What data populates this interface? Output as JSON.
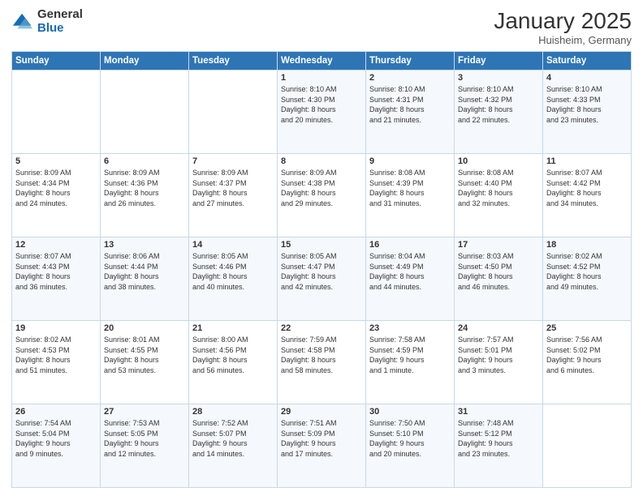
{
  "header": {
    "logo_general": "General",
    "logo_blue": "Blue",
    "month_title": "January 2025",
    "location": "Huisheim, Germany"
  },
  "days_of_week": [
    "Sunday",
    "Monday",
    "Tuesday",
    "Wednesday",
    "Thursday",
    "Friday",
    "Saturday"
  ],
  "weeks": [
    [
      {
        "day": "",
        "info": ""
      },
      {
        "day": "",
        "info": ""
      },
      {
        "day": "",
        "info": ""
      },
      {
        "day": "1",
        "info": "Sunrise: 8:10 AM\nSunset: 4:30 PM\nDaylight: 8 hours\nand 20 minutes."
      },
      {
        "day": "2",
        "info": "Sunrise: 8:10 AM\nSunset: 4:31 PM\nDaylight: 8 hours\nand 21 minutes."
      },
      {
        "day": "3",
        "info": "Sunrise: 8:10 AM\nSunset: 4:32 PM\nDaylight: 8 hours\nand 22 minutes."
      },
      {
        "day": "4",
        "info": "Sunrise: 8:10 AM\nSunset: 4:33 PM\nDaylight: 8 hours\nand 23 minutes."
      }
    ],
    [
      {
        "day": "5",
        "info": "Sunrise: 8:09 AM\nSunset: 4:34 PM\nDaylight: 8 hours\nand 24 minutes."
      },
      {
        "day": "6",
        "info": "Sunrise: 8:09 AM\nSunset: 4:36 PM\nDaylight: 8 hours\nand 26 minutes."
      },
      {
        "day": "7",
        "info": "Sunrise: 8:09 AM\nSunset: 4:37 PM\nDaylight: 8 hours\nand 27 minutes."
      },
      {
        "day": "8",
        "info": "Sunrise: 8:09 AM\nSunset: 4:38 PM\nDaylight: 8 hours\nand 29 minutes."
      },
      {
        "day": "9",
        "info": "Sunrise: 8:08 AM\nSunset: 4:39 PM\nDaylight: 8 hours\nand 31 minutes."
      },
      {
        "day": "10",
        "info": "Sunrise: 8:08 AM\nSunset: 4:40 PM\nDaylight: 8 hours\nand 32 minutes."
      },
      {
        "day": "11",
        "info": "Sunrise: 8:07 AM\nSunset: 4:42 PM\nDaylight: 8 hours\nand 34 minutes."
      }
    ],
    [
      {
        "day": "12",
        "info": "Sunrise: 8:07 AM\nSunset: 4:43 PM\nDaylight: 8 hours\nand 36 minutes."
      },
      {
        "day": "13",
        "info": "Sunrise: 8:06 AM\nSunset: 4:44 PM\nDaylight: 8 hours\nand 38 minutes."
      },
      {
        "day": "14",
        "info": "Sunrise: 8:05 AM\nSunset: 4:46 PM\nDaylight: 8 hours\nand 40 minutes."
      },
      {
        "day": "15",
        "info": "Sunrise: 8:05 AM\nSunset: 4:47 PM\nDaylight: 8 hours\nand 42 minutes."
      },
      {
        "day": "16",
        "info": "Sunrise: 8:04 AM\nSunset: 4:49 PM\nDaylight: 8 hours\nand 44 minutes."
      },
      {
        "day": "17",
        "info": "Sunrise: 8:03 AM\nSunset: 4:50 PM\nDaylight: 8 hours\nand 46 minutes."
      },
      {
        "day": "18",
        "info": "Sunrise: 8:02 AM\nSunset: 4:52 PM\nDaylight: 8 hours\nand 49 minutes."
      }
    ],
    [
      {
        "day": "19",
        "info": "Sunrise: 8:02 AM\nSunset: 4:53 PM\nDaylight: 8 hours\nand 51 minutes."
      },
      {
        "day": "20",
        "info": "Sunrise: 8:01 AM\nSunset: 4:55 PM\nDaylight: 8 hours\nand 53 minutes."
      },
      {
        "day": "21",
        "info": "Sunrise: 8:00 AM\nSunset: 4:56 PM\nDaylight: 8 hours\nand 56 minutes."
      },
      {
        "day": "22",
        "info": "Sunrise: 7:59 AM\nSunset: 4:58 PM\nDaylight: 8 hours\nand 58 minutes."
      },
      {
        "day": "23",
        "info": "Sunrise: 7:58 AM\nSunset: 4:59 PM\nDaylight: 9 hours\nand 1 minute."
      },
      {
        "day": "24",
        "info": "Sunrise: 7:57 AM\nSunset: 5:01 PM\nDaylight: 9 hours\nand 3 minutes."
      },
      {
        "day": "25",
        "info": "Sunrise: 7:56 AM\nSunset: 5:02 PM\nDaylight: 9 hours\nand 6 minutes."
      }
    ],
    [
      {
        "day": "26",
        "info": "Sunrise: 7:54 AM\nSunset: 5:04 PM\nDaylight: 9 hours\nand 9 minutes."
      },
      {
        "day": "27",
        "info": "Sunrise: 7:53 AM\nSunset: 5:05 PM\nDaylight: 9 hours\nand 12 minutes."
      },
      {
        "day": "28",
        "info": "Sunrise: 7:52 AM\nSunset: 5:07 PM\nDaylight: 9 hours\nand 14 minutes."
      },
      {
        "day": "29",
        "info": "Sunrise: 7:51 AM\nSunset: 5:09 PM\nDaylight: 9 hours\nand 17 minutes."
      },
      {
        "day": "30",
        "info": "Sunrise: 7:50 AM\nSunset: 5:10 PM\nDaylight: 9 hours\nand 20 minutes."
      },
      {
        "day": "31",
        "info": "Sunrise: 7:48 AM\nSunset: 5:12 PM\nDaylight: 9 hours\nand 23 minutes."
      },
      {
        "day": "",
        "info": ""
      }
    ]
  ]
}
